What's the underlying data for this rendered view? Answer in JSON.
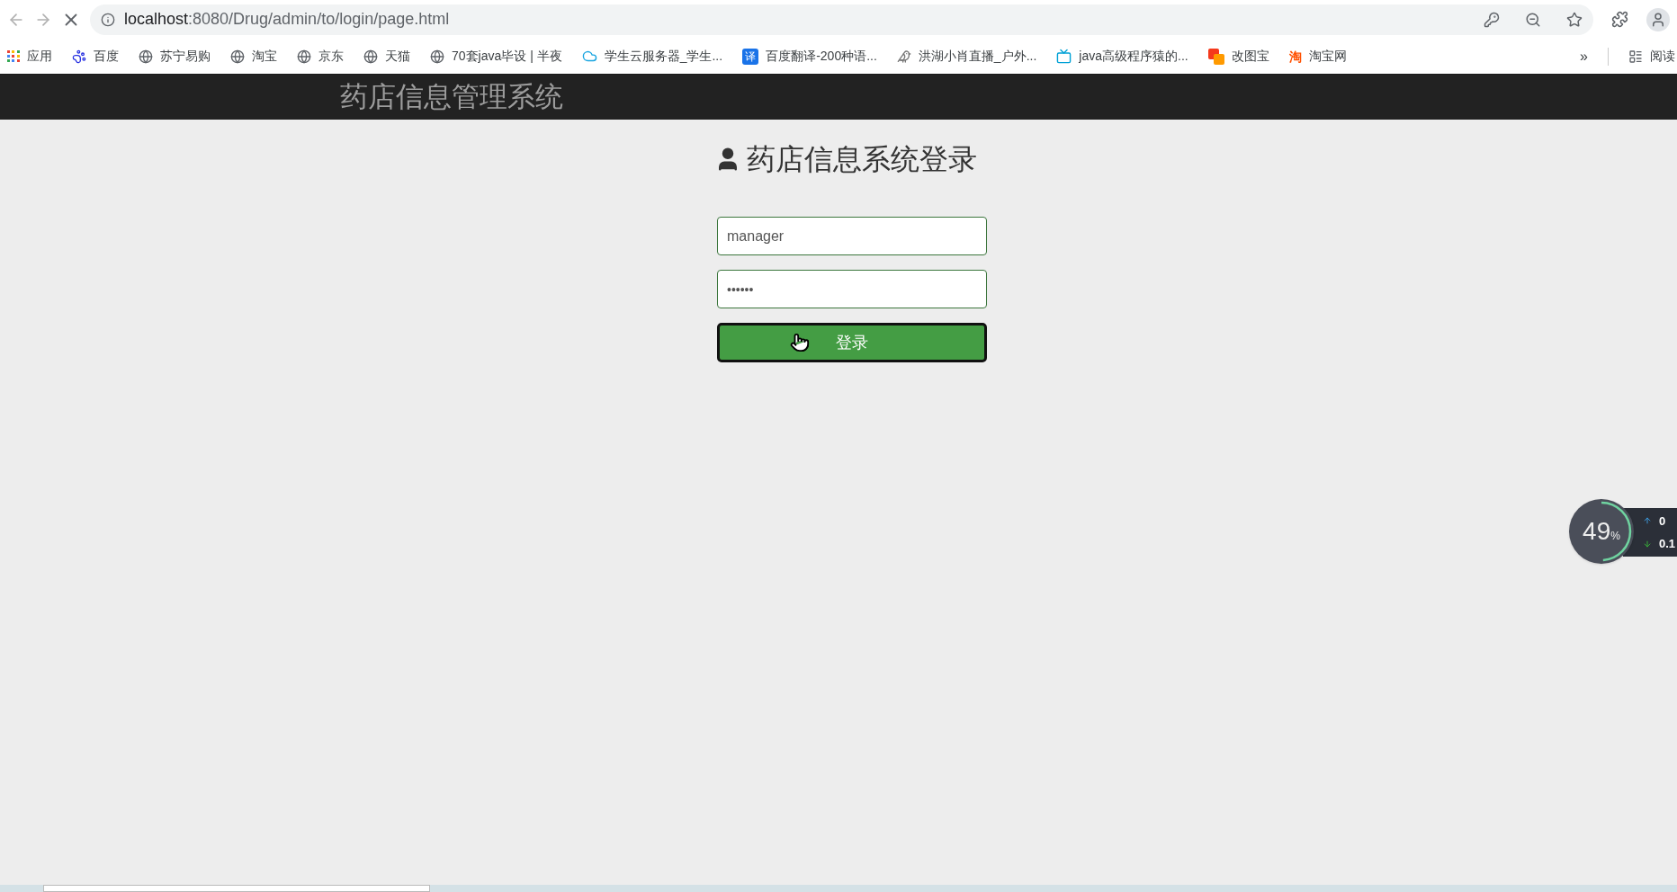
{
  "browser": {
    "url_host": "localhost",
    "url_path": ":8080/Drug/admin/to/login/page.html",
    "bookmarks": [
      {
        "label": "应用",
        "kind": "apps"
      },
      {
        "label": "百度",
        "kind": "paw"
      },
      {
        "label": "苏宁易购",
        "kind": "globe"
      },
      {
        "label": "淘宝",
        "kind": "globe"
      },
      {
        "label": "京东",
        "kind": "globe"
      },
      {
        "label": "天猫",
        "kind": "globe"
      },
      {
        "label": "70套java毕设 | 半夜",
        "kind": "globe"
      },
      {
        "label": "学生云服务器_学生...",
        "kind": "cloud"
      },
      {
        "label": "百度翻译-200种语...",
        "kind": "badge",
        "icon_text": "译"
      },
      {
        "label": "洪湖小肖直播_户外...",
        "kind": "bird"
      },
      {
        "label": "java高级程序猿的...",
        "kind": "tv"
      },
      {
        "label": "改图宝",
        "kind": "squares"
      },
      {
        "label": "淘宝网",
        "kind": "glyph",
        "icon_text": "淘"
      }
    ],
    "overflow": "»",
    "reading_list": "阅读"
  },
  "header": {
    "title": "药店信息管理系统"
  },
  "login": {
    "heading": "药店信息系统登录",
    "username": "manager",
    "password": "••••••",
    "submit": "登录"
  },
  "monitor": {
    "percent": "49",
    "unit": "%",
    "level": 0.49,
    "upload": "0",
    "download": "0.1"
  }
}
